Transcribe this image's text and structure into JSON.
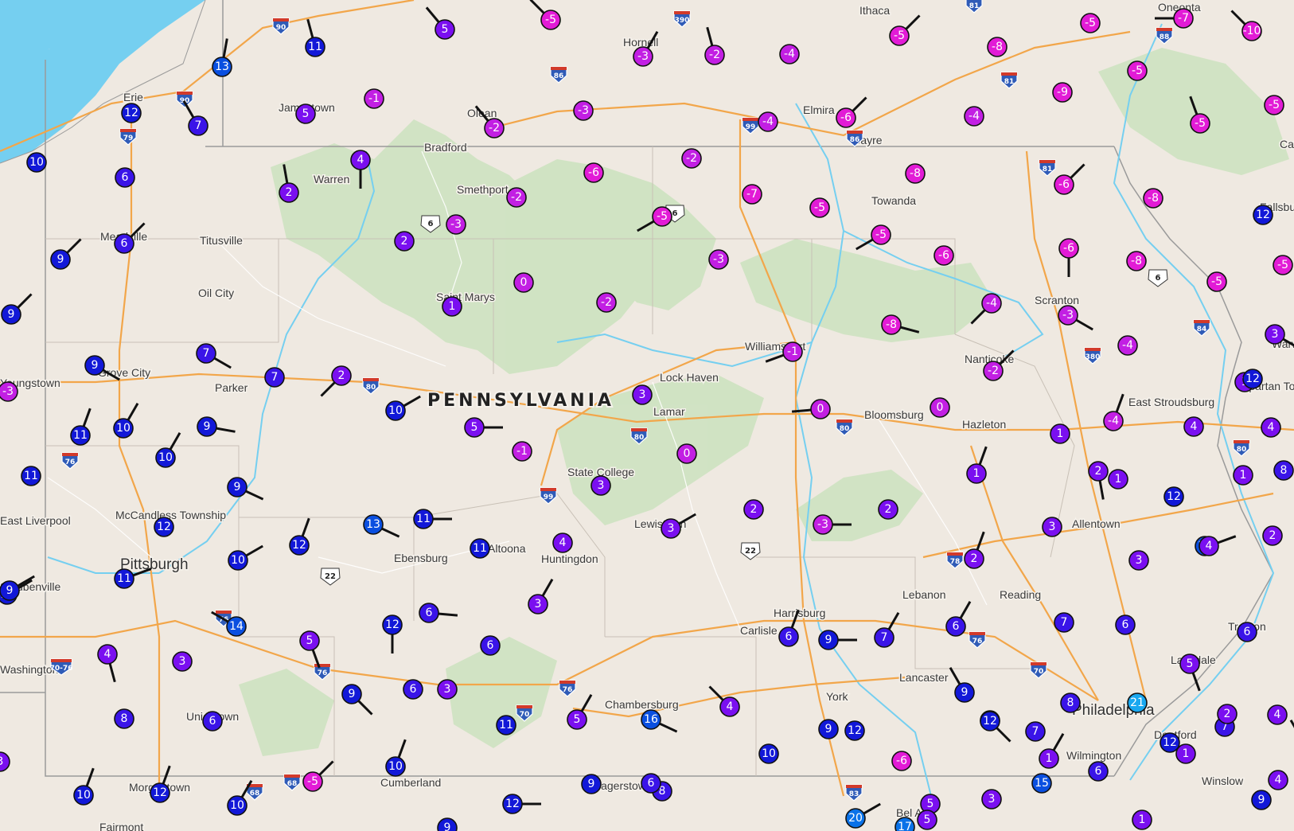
{
  "map": {
    "state_label": "PENNSYLVANIA",
    "colors": {
      "land": "#efe9e1",
      "water": "#75cff0",
      "forest": "#cfe3c2",
      "highway": "#f2a64a",
      "border": "#9a9a9a",
      "wind_barb": "#111111"
    },
    "temperature_color_scale": [
      {
        "temp": -10,
        "color": "#e21bd6"
      },
      {
        "temp": -5,
        "color": "#c21fe3"
      },
      {
        "temp": 0,
        "color": "#7a0ff0"
      },
      {
        "temp": 5,
        "color": "#3a14e8"
      },
      {
        "temp": 8,
        "color": "#1218d8"
      },
      {
        "temp": 12,
        "color": "#0a4fe0"
      },
      {
        "temp": 16,
        "color": "#0a72e8"
      },
      {
        "temp": 21,
        "color": "#19a8f0"
      }
    ]
  },
  "cities": [
    {
      "name": "Ithaca"
    },
    {
      "name": "Oneonta"
    },
    {
      "name": "Hornell"
    },
    {
      "name": "Olean"
    },
    {
      "name": "Elmira"
    },
    {
      "name": "Sayre"
    },
    {
      "name": "Erie"
    },
    {
      "name": "Jamestown"
    },
    {
      "name": "Bradford"
    },
    {
      "name": "Warren"
    },
    {
      "name": "Smethport"
    },
    {
      "name": "Towanda"
    },
    {
      "name": "Meadville"
    },
    {
      "name": "Titusville"
    },
    {
      "name": "Oil City"
    },
    {
      "name": "Saint Marys"
    },
    {
      "name": "Scranton"
    },
    {
      "name": "Williamsport"
    },
    {
      "name": "Lock Haven"
    },
    {
      "name": "Lamar"
    },
    {
      "name": "Nanticoke"
    },
    {
      "name": "Grove City"
    },
    {
      "name": "Parker"
    },
    {
      "name": "Youngstown"
    },
    {
      "name": "Bloomsburg"
    },
    {
      "name": "Hazleton"
    },
    {
      "name": "East Stroudsburg"
    },
    {
      "name": "Spartan Township"
    },
    {
      "name": "State College"
    },
    {
      "name": "Allentown"
    },
    {
      "name": "East Liverpool"
    },
    {
      "name": "McCandless Township"
    },
    {
      "name": "Lewistown"
    },
    {
      "name": "Pittsburgh"
    },
    {
      "name": "Ebensburg"
    },
    {
      "name": "Altoona"
    },
    {
      "name": "Huntingdon"
    },
    {
      "name": "Steubenville"
    },
    {
      "name": "Lebanon"
    },
    {
      "name": "Reading"
    },
    {
      "name": "Harrisburg"
    },
    {
      "name": "Carlisle"
    },
    {
      "name": "Trenton"
    },
    {
      "name": "Lansdale"
    },
    {
      "name": "Lancaster"
    },
    {
      "name": "York"
    },
    {
      "name": "Chambersburg"
    },
    {
      "name": "Philadelphia"
    },
    {
      "name": "Uniontown"
    },
    {
      "name": "Deptford"
    },
    {
      "name": "Wilmington"
    },
    {
      "name": "Cumberland"
    },
    {
      "name": "Morgantown"
    },
    {
      "name": "Hagerstown"
    },
    {
      "name": "Winslow"
    },
    {
      "name": "Bel Air"
    },
    {
      "name": "Fairmont"
    },
    {
      "name": "Fallsburg"
    },
    {
      "name": "Warwick"
    },
    {
      "name": "Washington"
    },
    {
      "name": "Catskill"
    }
  ],
  "route_shields": [
    {
      "kind": "interstate",
      "number": "90"
    },
    {
      "kind": "interstate",
      "number": "390"
    },
    {
      "kind": "interstate",
      "number": "81"
    },
    {
      "kind": "interstate",
      "number": "88"
    },
    {
      "kind": "interstate",
      "number": "86"
    },
    {
      "kind": "interstate",
      "number": "81"
    },
    {
      "kind": "interstate",
      "number": "90"
    },
    {
      "kind": "interstate",
      "number": "79"
    },
    {
      "kind": "interstate",
      "number": "99"
    },
    {
      "kind": "interstate",
      "number": "86"
    },
    {
      "kind": "interstate",
      "number": "81"
    },
    {
      "kind": "us",
      "number": "6"
    },
    {
      "kind": "us",
      "number": "6"
    },
    {
      "kind": "us",
      "number": "6"
    },
    {
      "kind": "interstate",
      "number": "84"
    },
    {
      "kind": "interstate",
      "number": "380"
    },
    {
      "kind": "interstate",
      "number": "80"
    },
    {
      "kind": "interstate",
      "number": "80"
    },
    {
      "kind": "interstate",
      "number": "80"
    },
    {
      "kind": "interstate",
      "number": "80"
    },
    {
      "kind": "interstate",
      "number": "76"
    },
    {
      "kind": "interstate",
      "number": "99"
    },
    {
      "kind": "us",
      "number": "22"
    },
    {
      "kind": "us",
      "number": "22"
    },
    {
      "kind": "interstate",
      "number": "78"
    },
    {
      "kind": "interstate",
      "number": "76"
    },
    {
      "kind": "interstate",
      "number": "76"
    },
    {
      "kind": "interstate",
      "number": "70"
    },
    {
      "kind": "interstate",
      "number": "70-76"
    },
    {
      "kind": "interstate",
      "number": "76"
    },
    {
      "kind": "interstate",
      "number": "70"
    },
    {
      "kind": "interstate",
      "number": "76"
    },
    {
      "kind": "interstate",
      "number": "68"
    },
    {
      "kind": "interstate",
      "number": "68"
    },
    {
      "kind": "interstate",
      "number": "83"
    }
  ],
  "stations": [
    {
      "temp": "-5",
      "wind_dir": 315
    },
    {
      "temp": "5",
      "wind_dir": 320
    },
    {
      "temp": "11",
      "wind_dir": 345
    },
    {
      "temp": "13",
      "wind_dir": 10
    },
    {
      "temp": "12",
      "wind_dir": 0
    },
    {
      "temp": "7",
      "wind_dir": 330
    },
    {
      "temp": "5",
      "wind_dir": 0
    },
    {
      "temp": "-1",
      "wind_dir": 0
    },
    {
      "temp": "4",
      "wind_dir": 180
    },
    {
      "temp": "10",
      "wind_dir": 0
    },
    {
      "temp": "6",
      "wind_dir": 0
    },
    {
      "temp": "2",
      "wind_dir": 350
    },
    {
      "temp": "-3",
      "wind_dir": 30
    },
    {
      "temp": "-2",
      "wind_dir": 345
    },
    {
      "temp": "-3",
      "wind_dir": 0
    },
    {
      "temp": "-2",
      "wind_dir": 320
    },
    {
      "temp": "-4",
      "wind_dir": 0
    },
    {
      "temp": "-4",
      "wind_dir": 0
    },
    {
      "temp": "-6",
      "wind_dir": 45
    },
    {
      "temp": "-5",
      "wind_dir": 45
    },
    {
      "temp": "-8",
      "wind_dir": 0
    },
    {
      "temp": "-5",
      "wind_dir": 0
    },
    {
      "temp": "-4",
      "wind_dir": 0
    },
    {
      "temp": "-7",
      "wind_dir": 270
    },
    {
      "temp": "-10",
      "wind_dir": 315
    },
    {
      "temp": "-5",
      "wind_dir": 0
    },
    {
      "temp": "-9",
      "wind_dir": 0
    },
    {
      "temp": "-5",
      "wind_dir": 0
    },
    {
      "temp": "-7",
      "wind_dir": 0
    },
    {
      "temp": "-5",
      "wind_dir": 340
    },
    {
      "temp": "-6",
      "wind_dir": 45
    },
    {
      "temp": "-8",
      "wind_dir": 0
    },
    {
      "temp": "-2",
      "wind_dir": 0
    },
    {
      "temp": "-6",
      "wind_dir": 0
    },
    {
      "temp": "-7",
      "wind_dir": 0
    },
    {
      "temp": "-5",
      "wind_dir": 0
    },
    {
      "temp": "-8",
      "wind_dir": 0
    },
    {
      "temp": "-6",
      "wind_dir": 0
    },
    {
      "temp": "-5",
      "wind_dir": 240
    },
    {
      "temp": "-5",
      "wind_dir": 240
    },
    {
      "temp": "-5",
      "wind_dir": 0
    },
    {
      "temp": "-8",
      "wind_dir": 0
    },
    {
      "temp": "-6",
      "wind_dir": 180
    },
    {
      "temp": "-5",
      "wind_dir": 0
    },
    {
      "temp": "-2",
      "wind_dir": 0
    },
    {
      "temp": "-3",
      "wind_dir": 0
    },
    {
      "temp": "2",
      "wind_dir": 0
    },
    {
      "temp": "9",
      "wind_dir": 45
    },
    {
      "temp": "6",
      "wind_dir": 45
    },
    {
      "temp": "9",
      "wind_dir": 45
    },
    {
      "temp": "0",
      "wind_dir": 0
    },
    {
      "temp": "-2",
      "wind_dir": 0
    },
    {
      "temp": "-3",
      "wind_dir": 0
    },
    {
      "temp": "1",
      "wind_dir": 0
    },
    {
      "temp": "-4",
      "wind_dir": 225
    },
    {
      "temp": "-8",
      "wind_dir": 105
    },
    {
      "temp": "-3",
      "wind_dir": 120
    },
    {
      "temp": "-1",
      "wind_dir": 250
    },
    {
      "temp": "-2",
      "wind_dir": 45
    },
    {
      "temp": "-4",
      "wind_dir": 0
    },
    {
      "temp": "9",
      "wind_dir": 120
    },
    {
      "temp": "7",
      "wind_dir": 120
    },
    {
      "temp": "7",
      "wind_dir": 0
    },
    {
      "temp": "2",
      "wind_dir": 225
    },
    {
      "temp": "9",
      "wind_dir": 100
    },
    {
      "temp": "10",
      "wind_dir": 30
    },
    {
      "temp": "11",
      "wind_dir": 20
    },
    {
      "temp": "11",
      "wind_dir": 0
    },
    {
      "temp": "10",
      "wind_dir": 30
    },
    {
      "temp": "9",
      "wind_dir": 115
    },
    {
      "temp": "10",
      "wind_dir": 60
    },
    {
      "temp": "5",
      "wind_dir": 90
    },
    {
      "temp": "3",
      "wind_dir": 0
    },
    {
      "temp": "-1",
      "wind_dir": 0
    },
    {
      "temp": "0",
      "wind_dir": 265
    },
    {
      "temp": "0",
      "wind_dir": 0
    },
    {
      "temp": "0",
      "wind_dir": 0
    },
    {
      "temp": "1",
      "wind_dir": 0
    },
    {
      "temp": "-4",
      "wind_dir": 20
    },
    {
      "temp": "4",
      "wind_dir": 0
    },
    {
      "temp": "1",
      "wind_dir": 0
    },
    {
      "temp": "1",
      "wind_dir": 20
    },
    {
      "temp": "-3",
      "wind_dir": 0
    },
    {
      "temp": "10",
      "wind_dir": 60
    },
    {
      "temp": "12",
      "wind_dir": 0
    },
    {
      "temp": "11",
      "wind_dir": 70
    },
    {
      "temp": "10",
      "wind_dir": 60
    },
    {
      "temp": "12",
      "wind_dir": 20
    },
    {
      "temp": "13",
      "wind_dir": 115
    },
    {
      "temp": "11",
      "wind_dir": 90
    },
    {
      "temp": "11",
      "wind_dir": 0
    },
    {
      "temp": "3",
      "wind_dir": 0
    },
    {
      "temp": "4",
      "wind_dir": 0
    },
    {
      "temp": "2",
      "wind_dir": 0
    },
    {
      "temp": "3",
      "wind_dir": 60
    },
    {
      "temp": "2",
      "wind_dir": 0
    },
    {
      "temp": "-3",
      "wind_dir": 90
    },
    {
      "temp": "2",
      "wind_dir": 20
    },
    {
      "temp": "3",
      "wind_dir": 0
    },
    {
      "temp": "3",
      "wind_dir": 0
    },
    {
      "temp": "2",
      "wind_dir": 0
    },
    {
      "temp": "13",
      "wind_dir": 0
    },
    {
      "temp": "12",
      "wind_dir": 0
    },
    {
      "temp": "3",
      "wind_dir": 120
    },
    {
      "temp": "4",
      "wind_dir": 0
    },
    {
      "temp": "1",
      "wind_dir": 0
    },
    {
      "temp": "4",
      "wind_dir": 70
    },
    {
      "temp": "1",
      "wind_dir": 0
    },
    {
      "temp": "2",
      "wind_dir": 170
    },
    {
      "temp": "12",
      "wind_dir": 0
    },
    {
      "temp": "12",
      "wind_dir": 0
    },
    {
      "temp": "8",
      "wind_dir": 0
    },
    {
      "temp": "9",
      "wind_dir": 60
    },
    {
      "temp": "4",
      "wind_dir": 165
    },
    {
      "temp": "14",
      "wind_dir": 300
    },
    {
      "temp": "12",
      "wind_dir": 180
    },
    {
      "temp": "6",
      "wind_dir": 95
    },
    {
      "temp": "5",
      "wind_dir": 160
    },
    {
      "temp": "3",
      "wind_dir": 0
    },
    {
      "temp": "6",
      "wind_dir": 0
    },
    {
      "temp": "6",
      "wind_dir": 0
    },
    {
      "temp": "3",
      "wind_dir": 30
    },
    {
      "temp": "3",
      "wind_dir": 0
    },
    {
      "temp": "5",
      "wind_dir": 30
    },
    {
      "temp": "11",
      "wind_dir": 0
    },
    {
      "temp": "16",
      "wind_dir": 115
    },
    {
      "temp": "4",
      "wind_dir": 315
    },
    {
      "temp": "6",
      "wind_dir": 20
    },
    {
      "temp": "9",
      "wind_dir": 90
    },
    {
      "temp": "6",
      "wind_dir": 30
    },
    {
      "temp": "7",
      "wind_dir": 30
    },
    {
      "temp": "6",
      "wind_dir": 0
    },
    {
      "temp": "5",
      "wind_dir": 160
    },
    {
      "temp": "7",
      "wind_dir": 0
    },
    {
      "temp": "8",
      "wind_dir": 0
    },
    {
      "temp": "7",
      "wind_dir": 0
    },
    {
      "temp": "7",
      "wind_dir": 0
    },
    {
      "temp": "7",
      "wind_dir": 0
    },
    {
      "temp": "6",
      "wind_dir": 0
    },
    {
      "temp": "12",
      "wind_dir": 0
    },
    {
      "temp": "21",
      "wind_dir": 0
    },
    {
      "temp": "6",
      "wind_dir": 0
    },
    {
      "temp": "8",
      "wind_dir": 0
    },
    {
      "temp": "6",
      "wind_dir": 0
    },
    {
      "temp": "10",
      "wind_dir": 20
    },
    {
      "temp": "12",
      "wind_dir": 135
    },
    {
      "temp": "4",
      "wind_dir": 0
    },
    {
      "temp": "10",
      "wind_dir": 20
    },
    {
      "temp": "12",
      "wind_dir": 20
    },
    {
      "temp": "10",
      "wind_dir": 30
    },
    {
      "temp": "12",
      "wind_dir": 90
    },
    {
      "temp": "20",
      "wind_dir": 60
    },
    {
      "temp": "17",
      "wind_dir": 0
    },
    {
      "temp": "9",
      "wind_dir": 135
    },
    {
      "temp": "9",
      "wind_dir": 0
    },
    {
      "temp": "8",
      "wind_dir": 0
    },
    {
      "temp": "9",
      "wind_dir": 0
    },
    {
      "temp": "10",
      "wind_dir": 330
    },
    {
      "temp": "10",
      "wind_dir": 0
    },
    {
      "temp": "6",
      "wind_dir": 0
    },
    {
      "temp": "15",
      "wind_dir": 0
    },
    {
      "temp": "9",
      "wind_dir": 330
    },
    {
      "temp": "12",
      "wind_dir": 0
    },
    {
      "temp": "-6",
      "wind_dir": 0
    },
    {
      "temp": "-5",
      "wind_dir": 45
    },
    {
      "temp": "1",
      "wind_dir": 30
    },
    {
      "temp": "1",
      "wind_dir": 0
    },
    {
      "temp": "1",
      "wind_dir": 0
    },
    {
      "temp": "9",
      "wind_dir": 0
    },
    {
      "temp": "5",
      "wind_dir": 0
    },
    {
      "temp": "3",
      "wind_dir": 0
    },
    {
      "temp": "2",
      "wind_dir": 0
    },
    {
      "temp": "4",
      "wind_dir": 0
    },
    {
      "temp": "3",
      "wind_dir": 0
    },
    {
      "temp": "9",
      "wind_dir": 0
    },
    {
      "temp": "5",
      "wind_dir": 0
    }
  ]
}
